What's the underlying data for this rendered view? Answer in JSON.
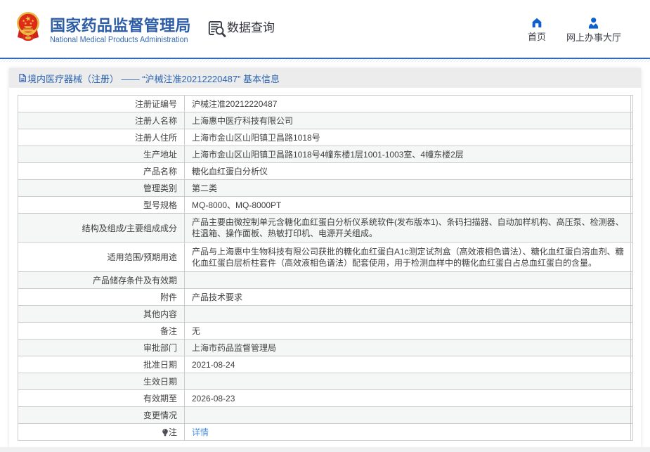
{
  "header": {
    "brand_cn": "国家药品监督管理局",
    "brand_en": "National Medical Products Administration",
    "data_query_label": "数据查询",
    "data_query_icon": "document-search-icon",
    "emblem_icon": "national-emblem-logo",
    "links": [
      {
        "label": "首页",
        "icon": "home-icon"
      },
      {
        "label": "网上办事大厅",
        "icon": "person-icon"
      }
    ]
  },
  "breadcrumb": {
    "icon": "document-icon",
    "text": "境内医疗器械（注册） —— “沪械注准20212220487” 基本信息"
  },
  "colors": {
    "brand_blue": "#2e5fa3",
    "icon_blue": "#0f62c4",
    "breadcrumb_blue": "#2c65b1",
    "link_blue": "#4a8fd6",
    "divider_blue": "#2e6bc0",
    "stripe_gray": "#f5f6f6"
  },
  "table": {
    "rows": [
      {
        "label": "注册证编号",
        "value": "沪械注准20212220487"
      },
      {
        "label": "注册人名称",
        "value": "上海惠中医疗科技有限公司"
      },
      {
        "label": "注册人住所",
        "value": "上海市金山区山阳镇卫昌路1018号"
      },
      {
        "label": "生产地址",
        "value": "上海市金山区山阳镇卫昌路1018号4幢东楼1层1001-1003室、4幢东楼2层"
      },
      {
        "label": "产品名称",
        "value": "糖化血红蛋白分析仪"
      },
      {
        "label": "管理类别",
        "value": "第二类"
      },
      {
        "label": "型号规格",
        "value": "MQ-8000、MQ-8000PT"
      },
      {
        "label": "结构及组成/主要组成成分",
        "value": "产品主要由微控制单元含糖化血红蛋白分析仪系统软件(发布版本1)、条码扫描器、自动加样机构、高压泵、检测器、柱温箱、操作面板、热敏打印机、电源开关组成。",
        "tall": true
      },
      {
        "label": "适用范围/预期用途",
        "value": "产品与上海惠中生物科技有限公司获批的糖化血红蛋白A1c测定试剂盒（高效液相色谱法）、糖化血红蛋白溶血剂、糖化血红蛋白层析柱套件（高效液相色谱法）配套使用，用于检测血样中的糖化血红蛋白占总血红蛋白的含量。",
        "tall": 2
      },
      {
        "label": "产品储存条件及有效期",
        "value": ""
      },
      {
        "label": "附件",
        "value": "产品技术要求"
      },
      {
        "label": "其他内容",
        "value": ""
      },
      {
        "label": "备注",
        "value": "无"
      },
      {
        "label": "审批部门",
        "value": "上海市药品监督管理局"
      },
      {
        "label": "批准日期",
        "value": "2021-08-24"
      },
      {
        "label": "生效日期",
        "value": ""
      },
      {
        "label": "有效期至",
        "value": "2026-08-23"
      },
      {
        "label": "变更情况",
        "value": ""
      },
      {
        "label": "注",
        "value": "详情",
        "icon": "bulb-icon",
        "link": true
      }
    ]
  }
}
